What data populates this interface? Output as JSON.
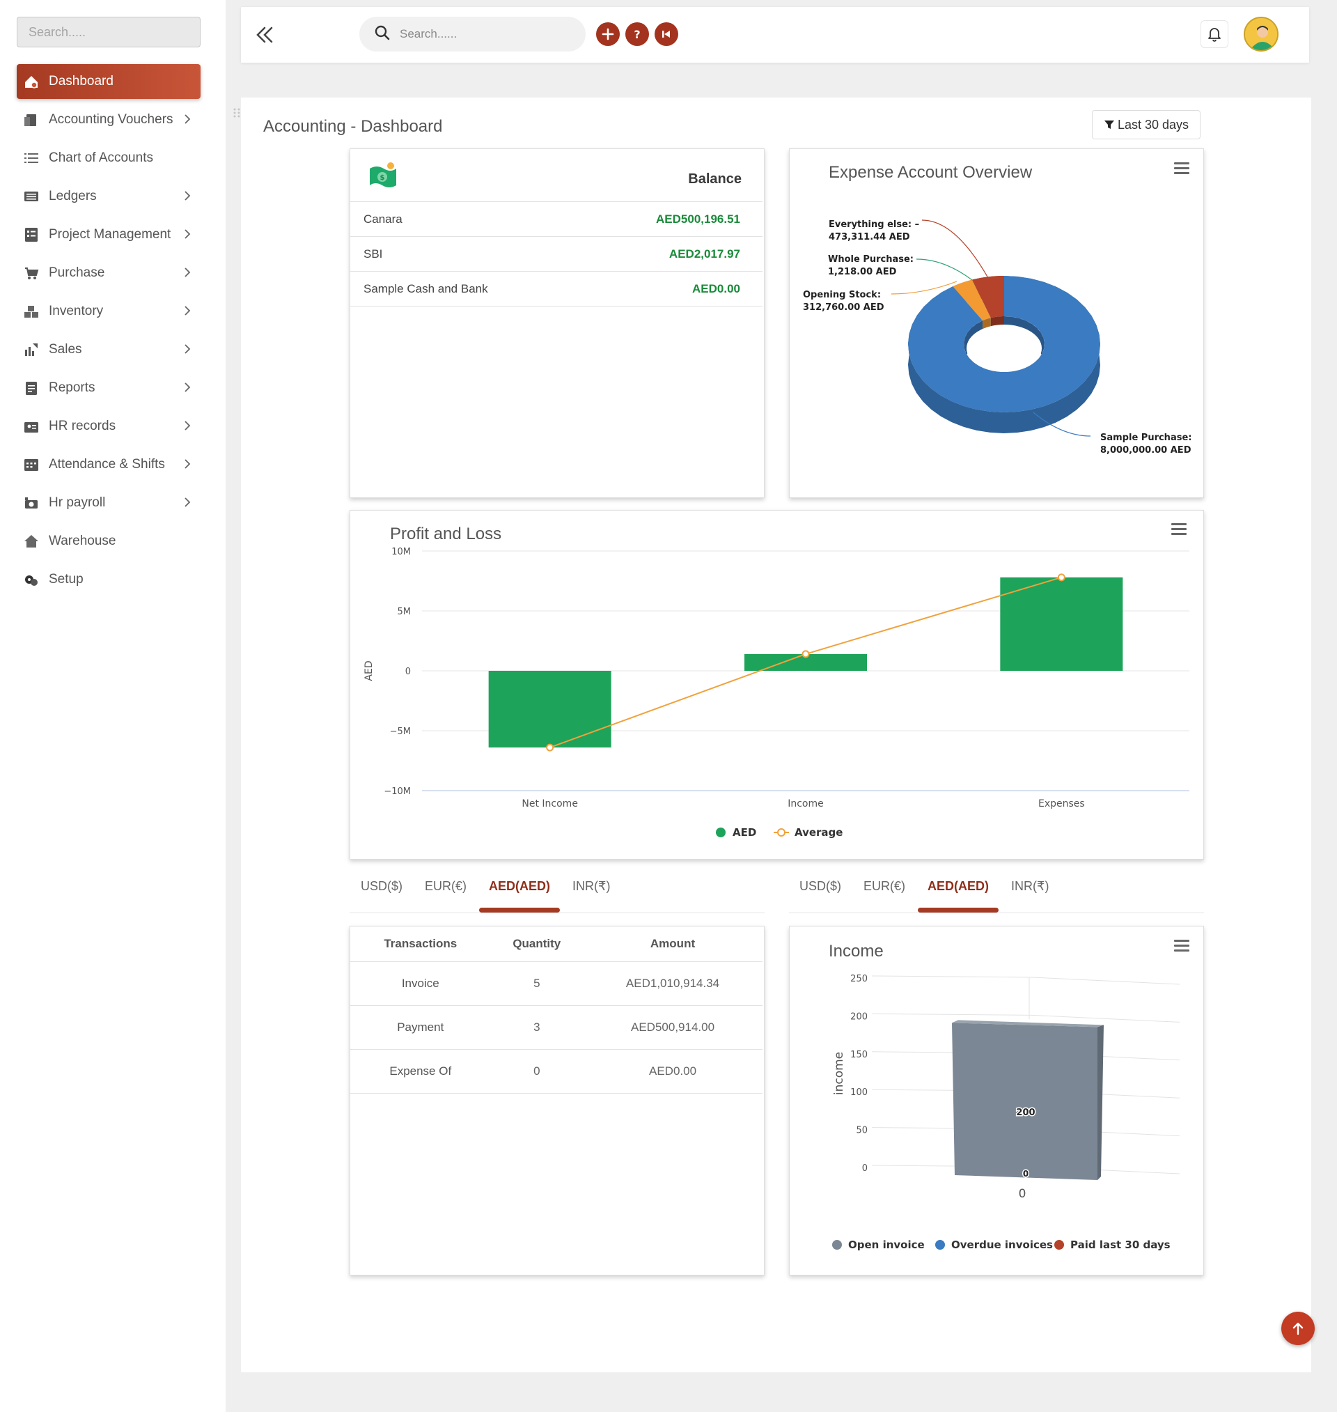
{
  "sidebar": {
    "search_placeholder": "Search.....",
    "items": [
      {
        "label": "Dashboard",
        "icon": "dashboard-icon",
        "active": true,
        "has_chevron": false
      },
      {
        "label": "Accounting Vouchers",
        "icon": "voucher-icon",
        "active": false,
        "has_chevron": true
      },
      {
        "label": "Chart of Accounts",
        "icon": "list-icon",
        "active": false,
        "has_chevron": false
      },
      {
        "label": "Ledgers",
        "icon": "ledger-icon",
        "active": false,
        "has_chevron": true
      },
      {
        "label": "Project Management",
        "icon": "project-icon",
        "active": false,
        "has_chevron": true
      },
      {
        "label": "Purchase",
        "icon": "cart-icon",
        "active": false,
        "has_chevron": true
      },
      {
        "label": "Inventory",
        "icon": "inventory-icon",
        "active": false,
        "has_chevron": true
      },
      {
        "label": "Sales",
        "icon": "sales-icon",
        "active": false,
        "has_chevron": true
      },
      {
        "label": "Reports",
        "icon": "reports-icon",
        "active": false,
        "has_chevron": true
      },
      {
        "label": "HR records",
        "icon": "hr-icon",
        "active": false,
        "has_chevron": true
      },
      {
        "label": "Attendance & Shifts",
        "icon": "calendar-icon",
        "active": false,
        "has_chevron": true
      },
      {
        "label": "Hr payroll",
        "icon": "payroll-icon",
        "active": false,
        "has_chevron": true
      },
      {
        "label": "Warehouse",
        "icon": "home-icon",
        "active": false,
        "has_chevron": false
      },
      {
        "label": "Setup",
        "icon": "setup-icon",
        "active": false,
        "has_chevron": false
      }
    ]
  },
  "topbar": {
    "search_placeholder": "Search......",
    "accent": "#a3331e"
  },
  "page": {
    "title": "Accounting - Dashboard",
    "filter_label": "Last 30 days"
  },
  "balance_card": {
    "header": "Balance",
    "rows": [
      {
        "name": "Canara",
        "value": "AED500,196.51"
      },
      {
        "name": "SBI",
        "value": "AED2,017.97"
      },
      {
        "name": "Sample Cash and Bank",
        "value": "AED0.00"
      }
    ]
  },
  "currency_tabs": [
    "USD($)",
    "EUR(€)",
    "AED(AED)",
    "INR(₹)"
  ],
  "active_currency": "AED(AED)",
  "transactions": {
    "headers": [
      "Transactions",
      "Quantity",
      "Amount"
    ],
    "rows": [
      {
        "name": "Invoice",
        "qty": "5",
        "amount": "AED1,010,914.34"
      },
      {
        "name": "Payment",
        "qty": "3",
        "amount": "AED500,914.00"
      },
      {
        "name": "Expense Of",
        "qty": "0",
        "amount": "AED0.00"
      }
    ]
  },
  "chart_data": [
    {
      "type": "pie",
      "title": "Expense Account Overview",
      "variant": "3d-donut",
      "slices": [
        {
          "name": "Sample Purchase",
          "value": 8000000.0,
          "label": "Sample Purchase:",
          "value_label": "8,000,000.00 AED",
          "color": "#3a7bc1"
        },
        {
          "name": "Opening Stock",
          "value": 312760.0,
          "label": "Opening Stock:",
          "value_label": "312,760.00 AED",
          "color": "#f39a33"
        },
        {
          "name": "Whole Purchase",
          "value": 1218.0,
          "label": "Whole Purchase:",
          "value_label": "1,218.00 AED",
          "color": "#2fa37a"
        },
        {
          "name": "Everything else",
          "value": 473311.44,
          "label": "Everything else: –",
          "value_label": "473,311.44 AED",
          "color": "#b5422a"
        }
      ]
    },
    {
      "type": "bar",
      "title": "Profit and Loss",
      "categories": [
        "Net Income",
        "Income",
        "Expenses"
      ],
      "ylabel": "AED",
      "ylim": [
        -10000000,
        10000000
      ],
      "yticks": [
        10000000,
        5000000,
        0,
        -5000000,
        -10000000
      ],
      "ytick_labels": [
        "10M",
        "5M",
        "0",
        "−5M",
        "−10M"
      ],
      "grid": true,
      "legend_position": "bottom",
      "series": [
        {
          "name": "AED",
          "type": "bar",
          "color": "#1ea35a",
          "values": [
            -6400000,
            1400000,
            7800000
          ]
        },
        {
          "name": "Average",
          "type": "line",
          "color": "#f0a23c",
          "values": [
            -6400000,
            1400000,
            7800000
          ]
        }
      ]
    },
    {
      "type": "bar",
      "title": "Income",
      "variant": "3d-column",
      "categories": [
        "0"
      ],
      "ylabel": "income",
      "ylim": [
        0,
        250
      ],
      "yticks": [
        0,
        50,
        100,
        150,
        200,
        250
      ],
      "grid": true,
      "legend_position": "bottom",
      "series": [
        {
          "name": "Open invoice",
          "color": "#7b8794",
          "values": [
            200
          ]
        },
        {
          "name": "Overdue invoices",
          "color": "#3a7bc1",
          "values": [
            0
          ]
        },
        {
          "name": "Paid last 30 days",
          "color": "#b5422a",
          "values": [
            0
          ]
        }
      ],
      "data_labels": [
        "200",
        "0"
      ]
    }
  ]
}
